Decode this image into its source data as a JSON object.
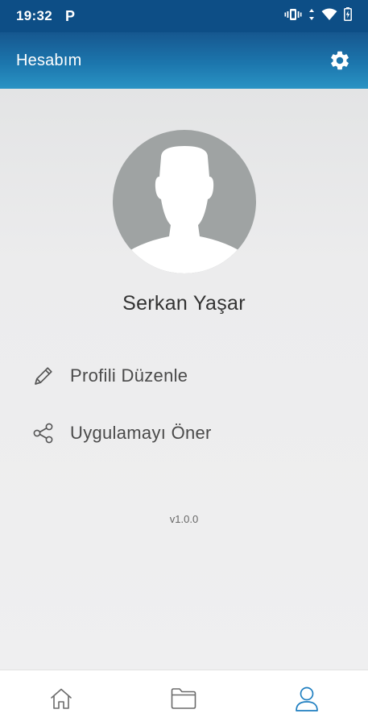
{
  "status_bar": {
    "time": "19:32",
    "notification_letter": "P",
    "icons": [
      "vibrate-icon",
      "data-arrows-icon",
      "wifi-icon",
      "battery-icon"
    ]
  },
  "app_bar": {
    "title": "Hesabım",
    "settings_icon": "gear-icon"
  },
  "profile": {
    "name": "Serkan Yaşar",
    "avatar_icon": "person-silhouette-icon"
  },
  "menu": [
    {
      "label": "Profili Düzenle",
      "icon": "pencil-icon"
    },
    {
      "label": "Uygulamayı Öner",
      "icon": "share-icon"
    }
  ],
  "version": "v1.0.0",
  "bottom_nav": [
    {
      "icon": "home-icon",
      "active": false
    },
    {
      "icon": "folder-icon",
      "active": false
    },
    {
      "icon": "user-icon",
      "active": true
    }
  ],
  "colors": {
    "status_bar": "#0d4e86",
    "app_bar_top": "#16578f",
    "app_bar_bottom": "#2a93c4",
    "avatar": "#9fa3a3",
    "nav_active": "#1f7fc1",
    "nav_inactive": "#6b6b6b"
  }
}
